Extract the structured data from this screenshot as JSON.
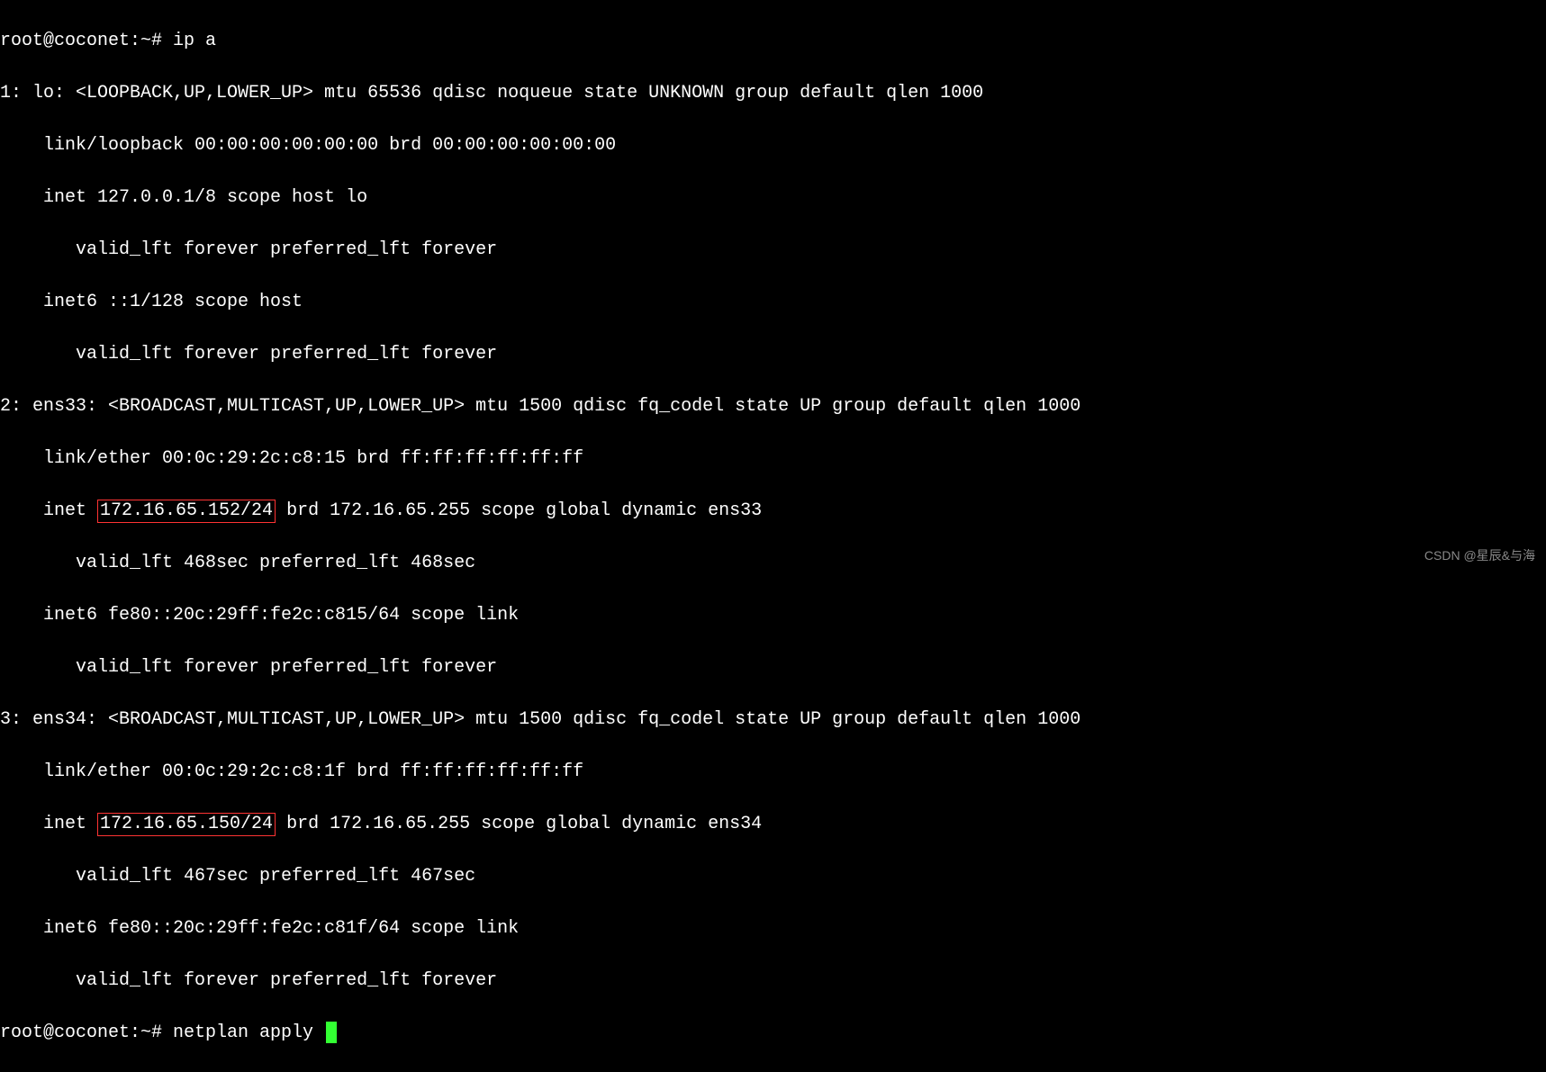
{
  "prompt1": "root@coconet:~# ",
  "cmd1": "ip a",
  "iface1_header": "1: lo: <LOOPBACK,UP,LOWER_UP> mtu 65536 qdisc noqueue state UNKNOWN group default qlen 1000",
  "iface1_link": "    link/loopback 00:00:00:00:00:00 brd 00:00:00:00:00:00",
  "iface1_inet": "    inet 127.0.0.1/8 scope host lo",
  "iface1_valid1": "       valid_lft forever preferred_lft forever",
  "iface1_inet6": "    inet6 ::1/128 scope host ",
  "iface1_valid2": "       valid_lft forever preferred_lft forever",
  "iface2_header": "2: ens33: <BROADCAST,MULTICAST,UP,LOWER_UP> mtu 1500 qdisc fq_codel state UP group default qlen 1000",
  "iface2_link": "    link/ether 00:0c:29:2c:c8:15 brd ff:ff:ff:ff:ff:ff",
  "iface2_inet_prefix": "    inet ",
  "iface2_ip": "172.16.65.152/24",
  "iface2_inet_suffix": " brd 172.16.65.255 scope global dynamic ens33",
  "iface2_valid1": "       valid_lft 468sec preferred_lft 468sec",
  "iface2_inet6": "    inet6 fe80::20c:29ff:fe2c:c815/64 scope link ",
  "iface2_valid2": "       valid_lft forever preferred_lft forever",
  "iface3_header": "3: ens34: <BROADCAST,MULTICAST,UP,LOWER_UP> mtu 1500 qdisc fq_codel state UP group default qlen 1000",
  "iface3_link": "    link/ether 00:0c:29:2c:c8:1f brd ff:ff:ff:ff:ff:ff",
  "iface3_inet_prefix": "    inet ",
  "iface3_ip": "172.16.65.150/24",
  "iface3_inet_suffix": " brd 172.16.65.255 scope global dynamic ens34",
  "iface3_valid1": "       valid_lft 467sec preferred_lft 467sec",
  "iface3_inet6": "    inet6 fe80::20c:29ff:fe2c:c81f/64 scope link ",
  "iface3_valid2": "       valid_lft forever preferred_lft forever",
  "prompt2": "root@coconet:~# ",
  "cmd2": "netplan apply ",
  "watermark": "CSDN @星辰&与海"
}
